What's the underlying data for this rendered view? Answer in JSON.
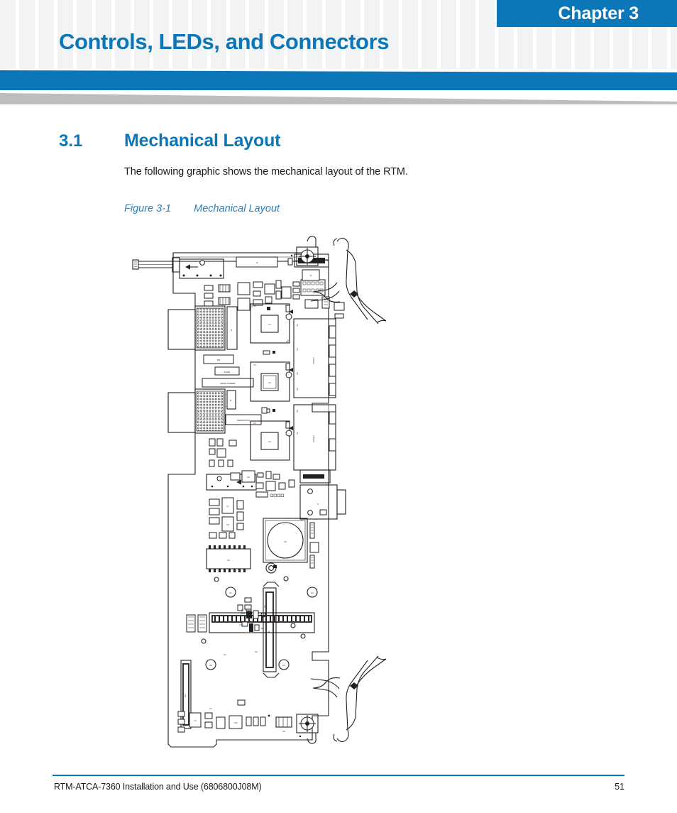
{
  "header": {
    "chapter_badge": "Chapter 3",
    "chapter_title": "Controls, LEDs, and Connectors",
    "accent_color": "#0b77b8",
    "checker_color": "#f2f3f4",
    "gray_wedge_color": "#bdbdbd"
  },
  "section": {
    "number": "3.1",
    "heading": "Mechanical Layout",
    "paragraph": "The following graphic shows the mechanical layout of the RTM."
  },
  "figure": {
    "label": "Figure 3-1",
    "title": "Mechanical Layout",
    "caption_color": "#2a7fb8",
    "description": "Line-art mechanical drawing of the RTM printed circuit board showing faceplate, ejector handles, backplane zone connectors, connector pin fields, integrated circuits, and mounting holes."
  },
  "footer": {
    "document_title": "RTM-ATCA-7360 Installation and Use (6806800J08M)",
    "page_number": "51",
    "rule_color": "#0b77b8"
  }
}
